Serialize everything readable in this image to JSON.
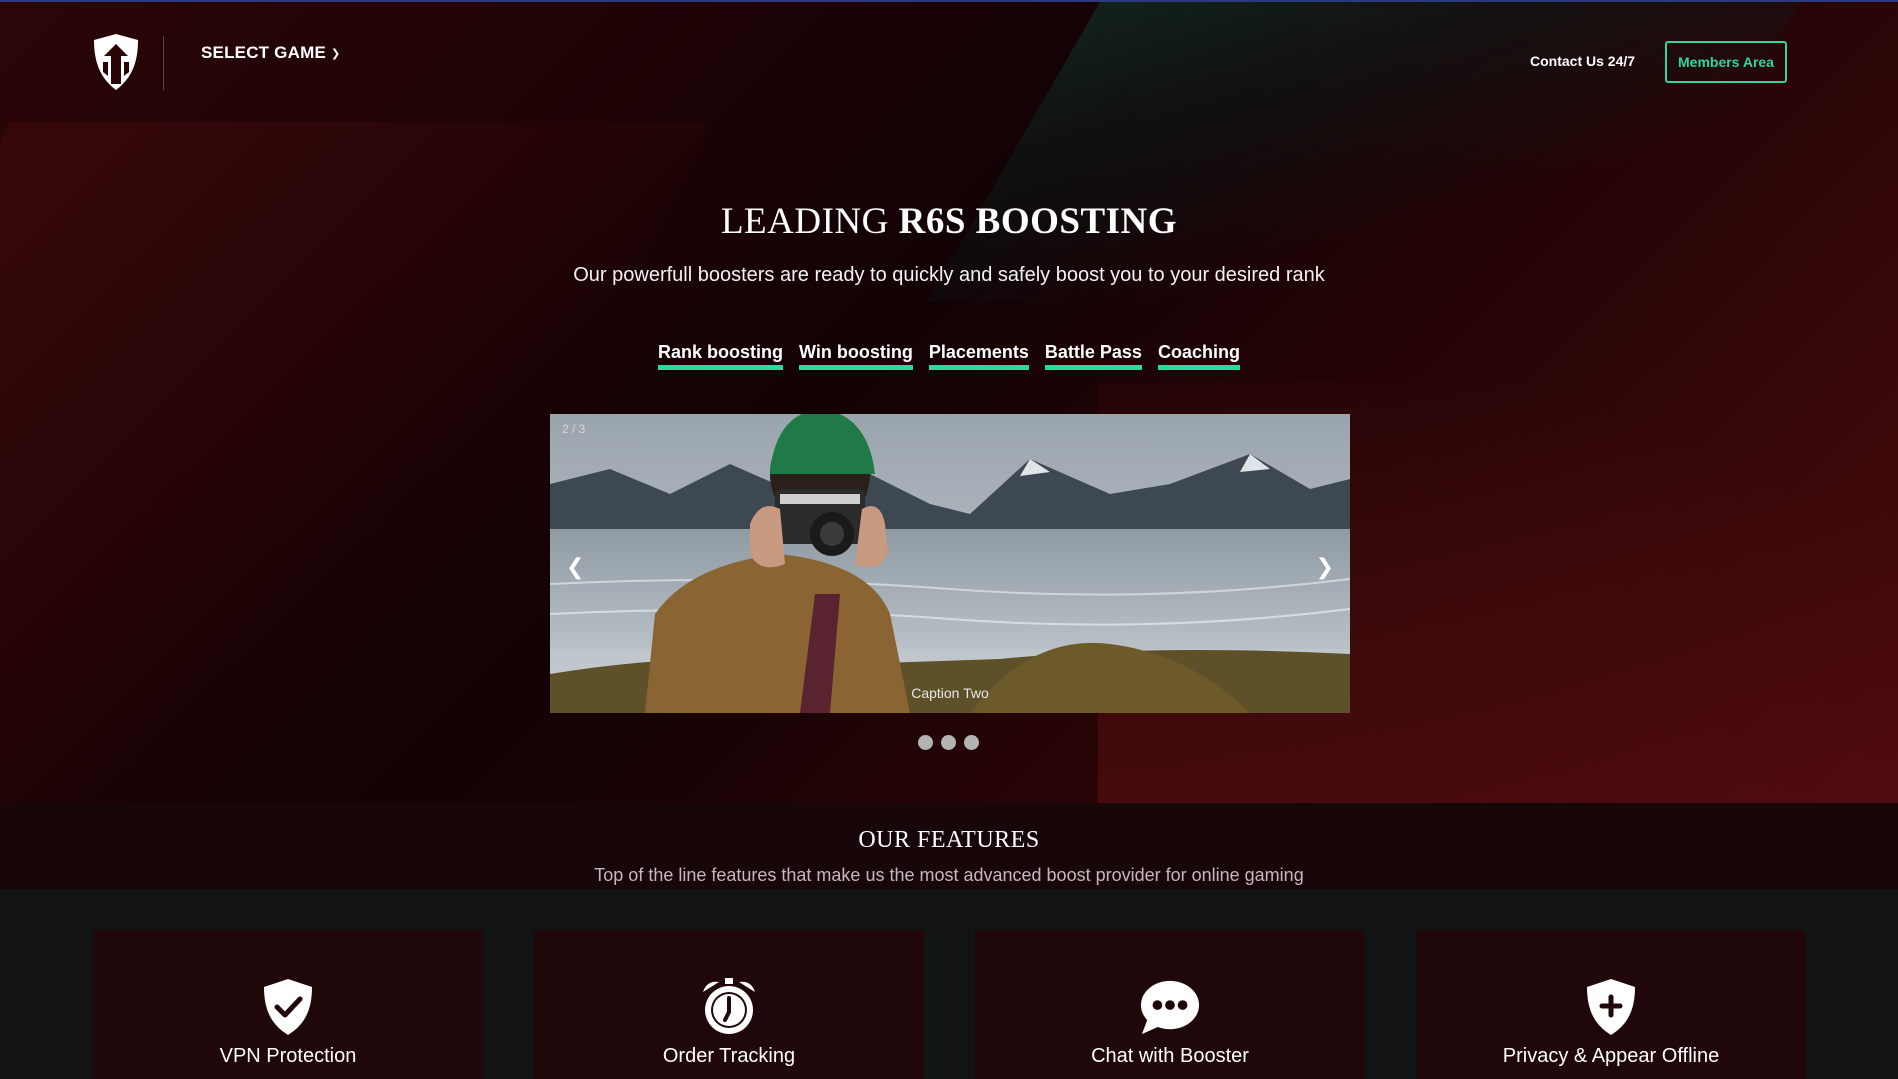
{
  "header": {
    "logo": "shield-arrow-logo",
    "select_game_label": "SELECT GAME",
    "contact_label": "Contact Us 24/7",
    "members_label": "Members Area"
  },
  "hero": {
    "title_prefix": "LEADING ",
    "title_bold": "R6S BOOSTING",
    "subtitle": "Our powerfull boosters are ready to quickly and safely boost you to your desired rank",
    "tabs": [
      {
        "label": "Rank boosting"
      },
      {
        "label": "Win boosting"
      },
      {
        "label": "Placements"
      },
      {
        "label": "Battle Pass"
      },
      {
        "label": "Coaching"
      }
    ],
    "accent_color": "#2fd6a0"
  },
  "carousel": {
    "counter": "2 / 3",
    "caption": "Caption Two",
    "prev_label": "❮",
    "next_label": "❯",
    "dots": 3
  },
  "features": {
    "title": "OUR FEATURES",
    "subtitle": "Top of the line features that make us the most advanced boost provider for online gaming",
    "items": [
      {
        "label": "VPN Protection",
        "icon": "shield-check-icon"
      },
      {
        "label": "Order Tracking",
        "icon": "alarm-clock-icon"
      },
      {
        "label": "Chat with Booster",
        "icon": "chat-bubble-icon"
      },
      {
        "label": "Privacy & Appear Offline",
        "icon": "shield-plus-icon"
      }
    ]
  }
}
